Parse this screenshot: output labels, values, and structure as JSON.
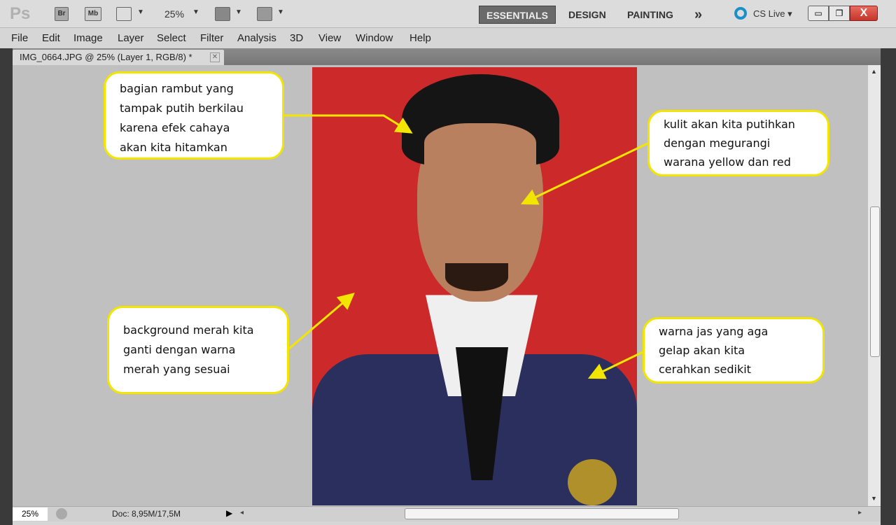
{
  "app": {
    "logo": "Ps",
    "bridge": "Br",
    "mini_bridge": "Mb",
    "zoom": "25%"
  },
  "workspaces": [
    {
      "label": "ESSENTIALS",
      "active": true
    },
    {
      "label": "DESIGN"
    },
    {
      "label": "PAINTING"
    }
  ],
  "more_label": "»",
  "cs_live": "CS Live",
  "menu": [
    "File",
    "Edit",
    "Image",
    "Layer",
    "Select",
    "Filter",
    "Analysis",
    "3D",
    "View",
    "Window",
    "Help"
  ],
  "document": {
    "tab_title": "IMG_0664.JPG @ 25% (Layer 1, RGB/8) *"
  },
  "status": {
    "zoom": "25%",
    "doc": "Doc: 8,95M/17,5M"
  },
  "callouts": [
    {
      "lines": [
        "bagian rambut yang",
        "tampak putih berkilau",
        "karena efek cahaya",
        "akan kita hitamkan"
      ]
    },
    {
      "lines": [
        "kulit akan kita putihkan",
        "dengan megurangi",
        "warana yellow dan red"
      ]
    },
    {
      "lines": [
        "background merah kita",
        "ganti dengan warna",
        "merah yang sesuai"
      ]
    },
    {
      "lines": [
        "warna jas yang aga",
        "gelap akan kita",
        "cerahkan sedikit"
      ]
    }
  ],
  "colors": {
    "callout_border": "#f2e600",
    "arrow": "#f2e600",
    "photo_bg": "#cc2a2a",
    "jacket": "#2a2f5e",
    "close": "#d8453a"
  }
}
